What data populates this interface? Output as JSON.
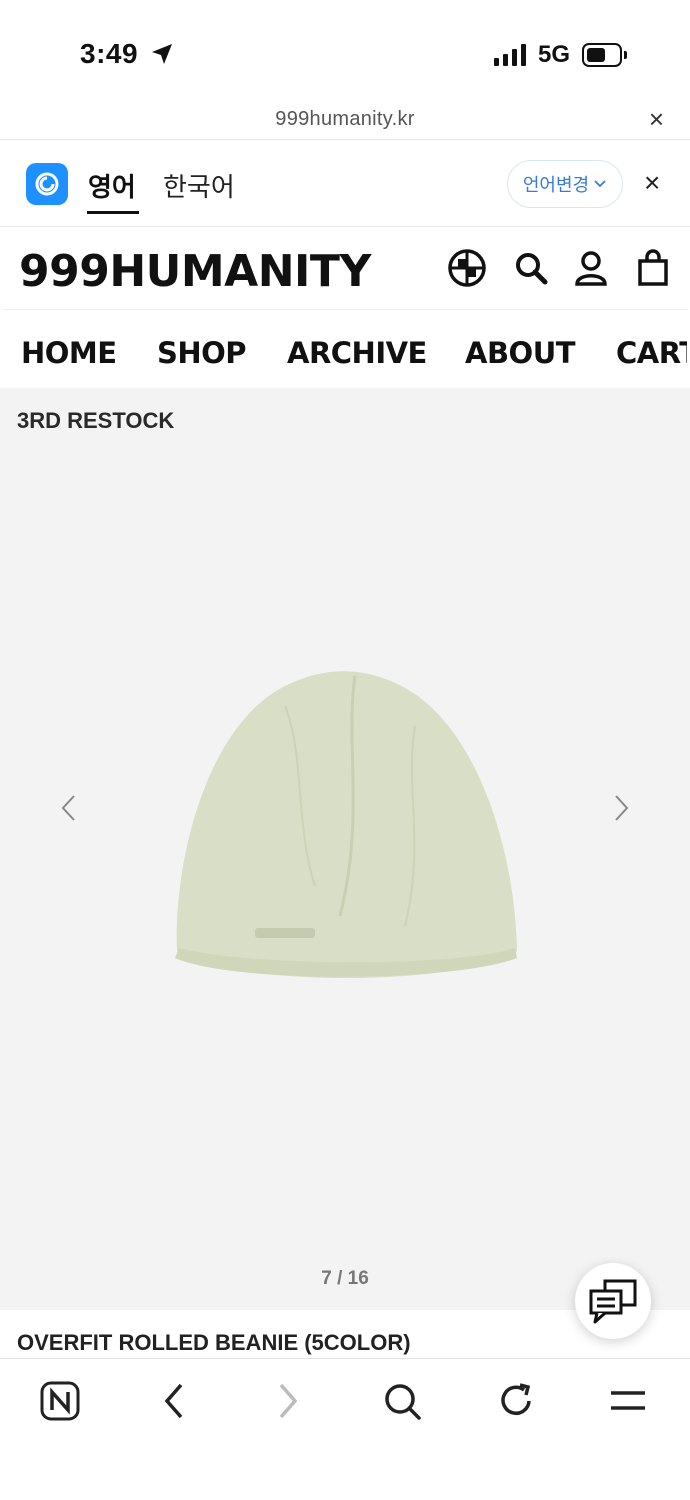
{
  "status": {
    "time": "3:49",
    "network": "5G"
  },
  "url_bar": {
    "domain": "999humanity.kr",
    "close_glyph": "×"
  },
  "translate": {
    "source_lang": "영어",
    "target_lang": "한국어",
    "change_label": "언어변경",
    "close_glyph": "×"
  },
  "site": {
    "logo": "999HUMANITY",
    "nav": [
      "HOME",
      "SHOP",
      "ARCHIVE",
      "ABOUT",
      "CART"
    ]
  },
  "product": {
    "badge": "3RD RESTOCK",
    "pager": "7 / 16",
    "title": "OVERFIT ROLLED BEANIE (5COLOR)",
    "beanie_color": "#d9dfc6"
  },
  "toolbar": {
    "icons": [
      "naver-icon",
      "back-icon",
      "forward-icon",
      "search-icon",
      "reload-icon",
      "menu-icon"
    ]
  }
}
